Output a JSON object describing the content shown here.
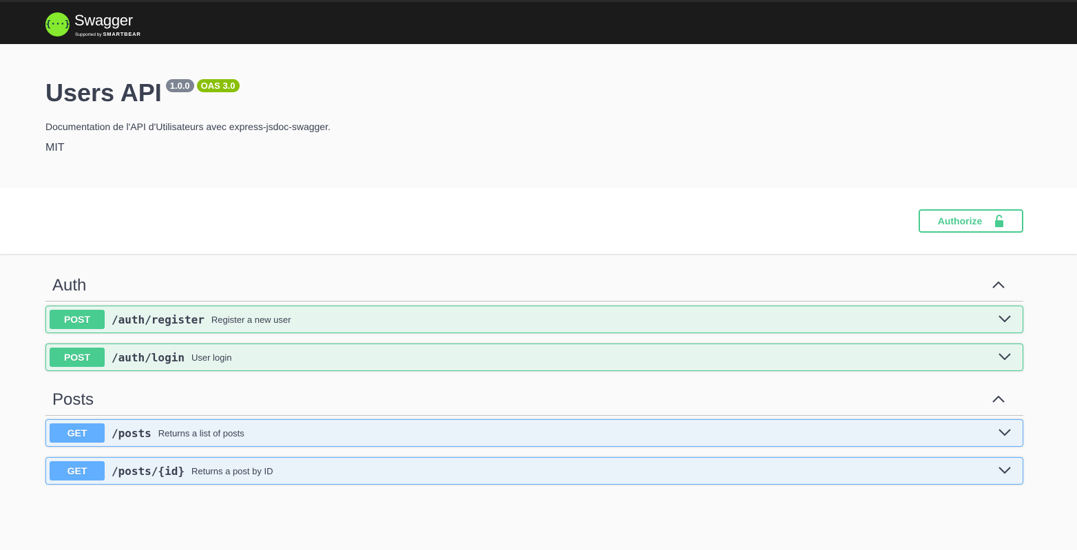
{
  "topbar": {
    "logo_glyph": "{···}",
    "brand_name": "Swagger",
    "brand_sub_prefix": "Supported by",
    "brand_sub_company": "SMARTBEAR"
  },
  "info": {
    "title": "Users API",
    "version": "1.0.0",
    "oas": "OAS 3.0",
    "description": "Documentation de l'API d'Utilisateurs avec express-jsdoc-swagger.",
    "license": "MIT"
  },
  "scheme": {
    "authorize_label": "Authorize",
    "authorize_icon": "lock-icon"
  },
  "tags": [
    {
      "name": "Auth",
      "operations": [
        {
          "method": "POST",
          "path": "/auth/register",
          "summary": "Register a new user"
        },
        {
          "method": "POST",
          "path": "/auth/login",
          "summary": "User login"
        }
      ]
    },
    {
      "name": "Posts",
      "operations": [
        {
          "method": "GET",
          "path": "/posts",
          "summary": "Returns a list of posts"
        },
        {
          "method": "GET",
          "path": "/posts/{id}",
          "summary": "Returns a post by ID"
        }
      ]
    }
  ],
  "colors": {
    "post": "#49cc90",
    "get": "#61affe",
    "version_badge": "#7d8492",
    "oas_badge": "#89bf04",
    "logo": "#85ea2d"
  }
}
